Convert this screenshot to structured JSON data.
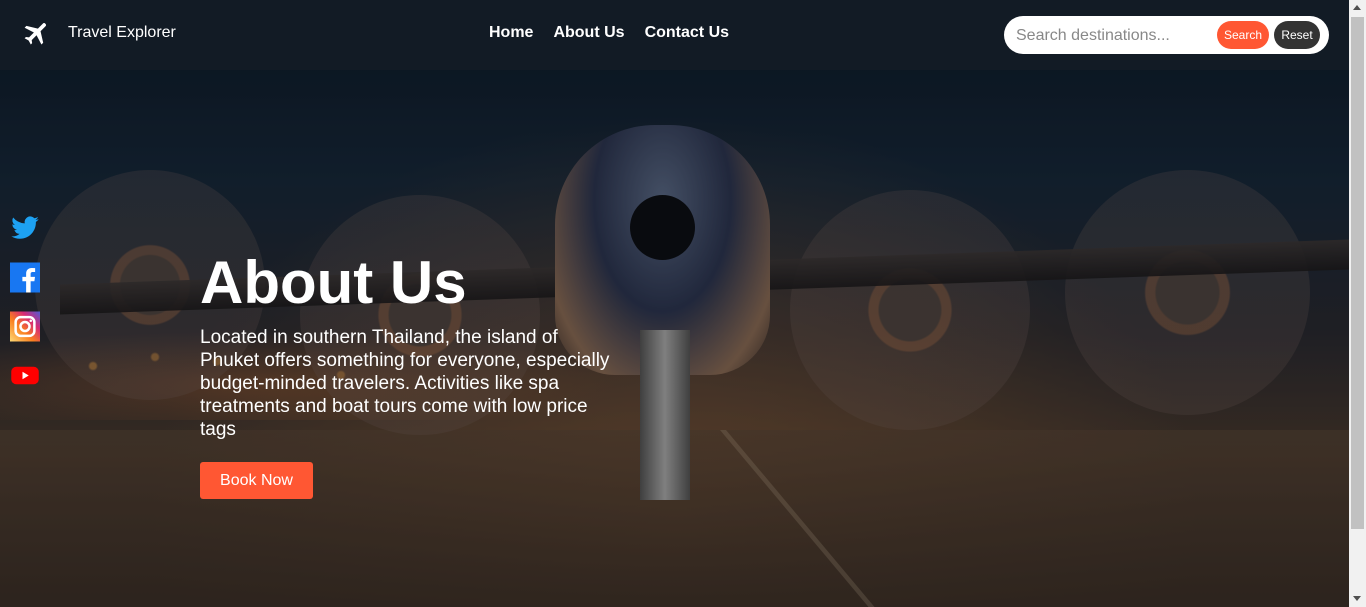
{
  "brand": {
    "name": "Travel Explorer",
    "icon": "airplane-icon"
  },
  "nav": [
    {
      "label": "Home"
    },
    {
      "label": "About Us"
    },
    {
      "label": "Contact Us"
    }
  ],
  "search": {
    "placeholder": "Search destinations...",
    "value": "",
    "search_label": "Search",
    "reset_label": "Reset"
  },
  "social": [
    "twitter-icon",
    "facebook-icon",
    "instagram-icon",
    "youtube-icon"
  ],
  "hero": {
    "title": "About Us",
    "description": "Located in southern Thailand, the island of Phuket offers something for everyone, especially budget-minded travelers. Activities like spa treatments and boat tours come with low price tags",
    "button_label": "Book Now"
  },
  "colors": {
    "accent": "#ff5733",
    "navbar": "#141c26",
    "reset": "#333333"
  }
}
